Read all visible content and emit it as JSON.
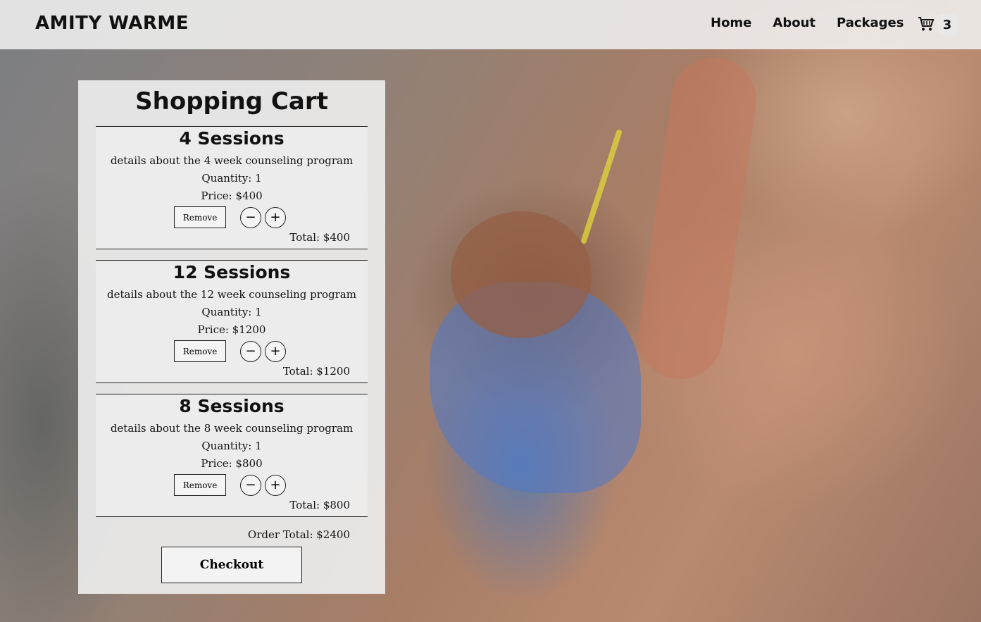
{
  "brand": "AMITY WARME",
  "nav": {
    "links": [
      "Home",
      "About",
      "Packages"
    ],
    "cart_count": "3"
  },
  "cart": {
    "title": "Shopping Cart",
    "items": [
      {
        "title": "4 Sessions",
        "description": "details about the 4 week counseling program",
        "quantity": "Quantity: 1",
        "price": "Price: $400",
        "total": "Total: $400",
        "remove_label": "Remove",
        "minus_label": "−",
        "plus_label": "+"
      },
      {
        "title": "12 Sessions",
        "description": "details about the 12 week counseling program",
        "quantity": "Quantity: 1",
        "price": "Price: $1200",
        "total": "Total: $1200",
        "remove_label": "Remove",
        "minus_label": "−",
        "plus_label": "+"
      },
      {
        "title": "8 Sessions",
        "description": "details about the 8 week counseling program",
        "quantity": "Quantity: 1",
        "price": "Price: $800",
        "total": "Total: $800",
        "remove_label": "Remove",
        "minus_label": "−",
        "plus_label": "+"
      }
    ],
    "order_total": "Order Total: $2400",
    "checkout_label": "Checkout"
  },
  "icons": {
    "cart": "shopping-cart-icon"
  }
}
